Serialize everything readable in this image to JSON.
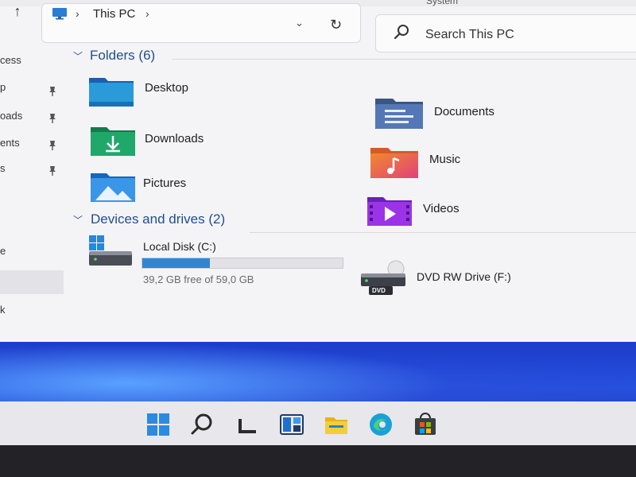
{
  "window": {
    "title_fragment": "System"
  },
  "toolbar": {
    "up_glyph": "↑",
    "breadcrumb_chevron": "›",
    "breadcrumb_label": "This PC",
    "dropdown_glyph": "⌄",
    "refresh_glyph": "↻"
  },
  "search": {
    "placeholder": "Search This PC"
  },
  "sidebar": {
    "items": [
      {
        "label": "cess"
      },
      {
        "label": "p"
      },
      {
        "label": "oads"
      },
      {
        "label": "ents"
      },
      {
        "label": "s"
      },
      {
        "label": "e"
      },
      {
        "label": "k"
      }
    ]
  },
  "folders": {
    "header": "Folders (6)",
    "items": [
      {
        "label": "Desktop",
        "icon": "desktop-folder-icon"
      },
      {
        "label": "Documents",
        "icon": "documents-folder-icon"
      },
      {
        "label": "Downloads",
        "icon": "downloads-folder-icon"
      },
      {
        "label": "Music",
        "icon": "music-folder-icon"
      },
      {
        "label": "Pictures",
        "icon": "pictures-folder-icon"
      },
      {
        "label": "Videos",
        "icon": "videos-folder-icon"
      }
    ]
  },
  "devices": {
    "header": "Devices and drives (2)",
    "drives": [
      {
        "label": "Local Disk (C:)",
        "free_text": "39,2 GB free of 59,0 GB",
        "used_fraction": 0.336
      },
      {
        "label": "DVD RW Drive (F:)",
        "badge": "DVD"
      }
    ]
  },
  "colors": {
    "accent": "#2e86d3",
    "header_blue": "#1f4f8f"
  },
  "taskbar": {
    "icons": [
      "windows-start-icon",
      "search-icon",
      "task-view-icon",
      "widgets-icon",
      "file-explorer-icon",
      "edge-icon",
      "store-icon"
    ],
    "tray_chevron": "∧"
  }
}
